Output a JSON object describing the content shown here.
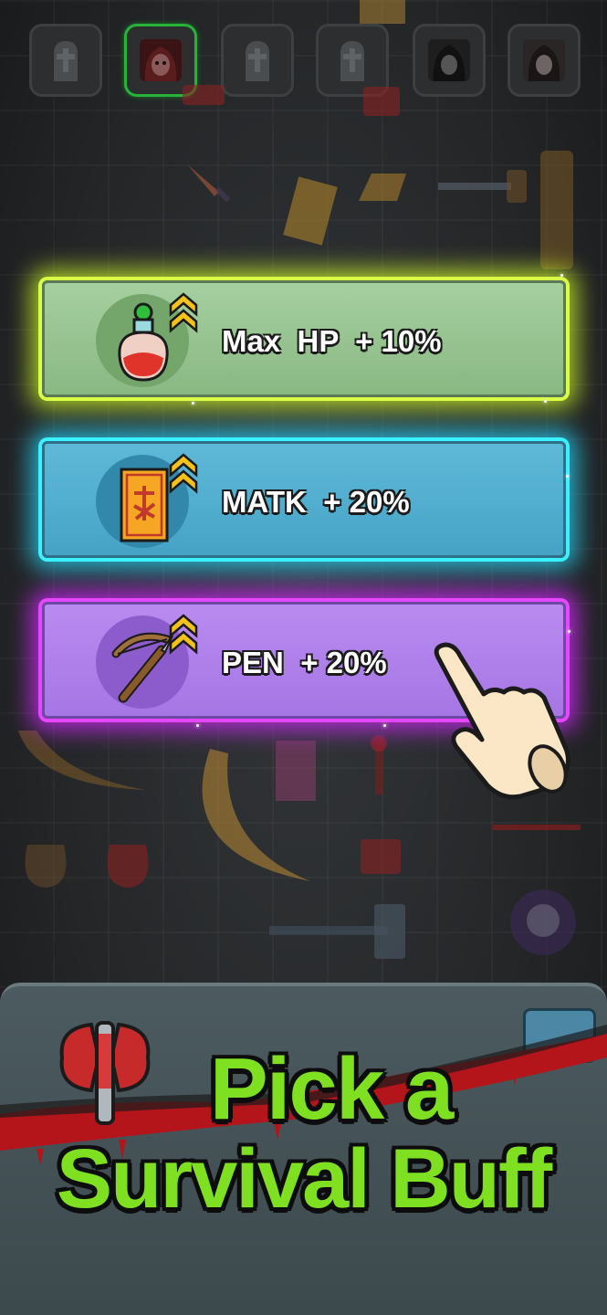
{
  "buffs": [
    {
      "label": "Max  HP  + 10%",
      "icon": "potion-icon",
      "color": "#89b883",
      "glow": "#d8ff46"
    },
    {
      "label": "MATK  + 20%",
      "icon": "talisman-icon",
      "color": "#47a3c6",
      "glow": "#3cf1ff"
    },
    {
      "label": "PEN  + 20%",
      "icon": "crossbow-icon",
      "color": "#a676e4",
      "glow": "#e447ff"
    }
  ],
  "hero_slots": [
    {
      "icon": "tombstone-icon",
      "active": false
    },
    {
      "icon": "ghost-portrait-icon",
      "active": true
    },
    {
      "icon": "tombstone-icon",
      "active": false
    },
    {
      "icon": "tombstone-icon",
      "active": false
    },
    {
      "icon": "ghost-portrait-icon",
      "active": false
    },
    {
      "icon": "ghost-portrait-icon",
      "active": false
    }
  ],
  "promo": {
    "line1": "Pick a",
    "line2": "Survival Buff",
    "text_color": "#7ee021",
    "emblem": "axe-icon"
  },
  "pointer": "pointing-hand-icon"
}
